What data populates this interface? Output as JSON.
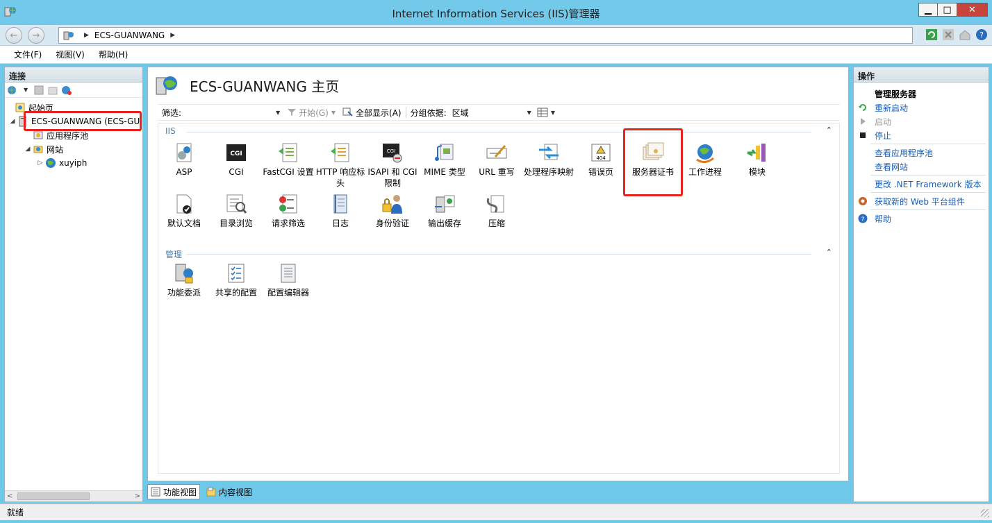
{
  "window": {
    "title": "Internet Information Services (IIS)管理器",
    "controls": {
      "minimize": "▁",
      "maximize": "□",
      "close": "✕"
    }
  },
  "address_bar": {
    "back": "←",
    "forward": "→",
    "crumbs": [
      "ECS-GUANWANG"
    ]
  },
  "menu": [
    "文件(F)",
    "视图(V)",
    "帮助(H)"
  ],
  "connections": {
    "header": "连接",
    "tree": [
      {
        "label": "起始页",
        "icon": "start-page-icon"
      },
      {
        "label": "ECS-GUANWANG (ECS-GU",
        "icon": "server-icon",
        "selected": true
      },
      {
        "label": "应用程序池",
        "icon": "app-pool-icon"
      },
      {
        "label": "网站",
        "icon": "sites-folder-icon"
      },
      {
        "label": "xuyiph",
        "icon": "site-globe-icon"
      }
    ]
  },
  "main": {
    "title": "ECS-GUANWANG 主页",
    "filter_label": "筛选:",
    "go_label": "开始(G)",
    "show_all_label": "全部显示(A)",
    "group_by_label": "分组依据:",
    "group_by_value": "区域",
    "sections": [
      {
        "name": "IIS",
        "features": [
          {
            "label": "ASP",
            "icon": "asp-icon"
          },
          {
            "label": "CGI",
            "icon": "cgi-icon"
          },
          {
            "label": "FastCGI 设置",
            "icon": "fastcgi-icon"
          },
          {
            "label": "HTTP 响应标头",
            "icon": "http-headers-icon"
          },
          {
            "label": "ISAPI 和 CGI 限制",
            "icon": "isapi-cgi-icon"
          },
          {
            "label": "MIME 类型",
            "icon": "mime-icon"
          },
          {
            "label": "URL 重写",
            "icon": "url-rewrite-icon"
          },
          {
            "label": "处理程序映射",
            "icon": "handler-mappings-icon"
          },
          {
            "label": "错误页",
            "icon": "error-pages-icon"
          },
          {
            "label": "服务器证书",
            "icon": "server-certificates-icon"
          },
          {
            "label": "工作进程",
            "icon": "worker-processes-icon"
          },
          {
            "label": "模块",
            "icon": "modules-icon"
          },
          {
            "label": "默认文档",
            "icon": "default-document-icon"
          },
          {
            "label": "目录浏览",
            "icon": "directory-browsing-icon"
          },
          {
            "label": "请求筛选",
            "icon": "request-filtering-icon"
          },
          {
            "label": "日志",
            "icon": "logging-icon"
          },
          {
            "label": "身份验证",
            "icon": "authentication-icon"
          },
          {
            "label": "输出缓存",
            "icon": "output-caching-icon"
          },
          {
            "label": "压缩",
            "icon": "compression-icon"
          }
        ]
      },
      {
        "name": "管理",
        "features": [
          {
            "label": "功能委派",
            "icon": "feature-delegation-icon"
          },
          {
            "label": "共享的配置",
            "icon": "shared-config-icon"
          },
          {
            "label": "配置编辑器",
            "icon": "config-editor-icon"
          }
        ]
      }
    ],
    "tabs": [
      {
        "label": "功能视图",
        "active": true
      },
      {
        "label": "内容视图",
        "active": false
      }
    ]
  },
  "actions": {
    "header": "操作",
    "items": {
      "manage_server": "管理服务器",
      "restart": "重新启动",
      "start": "启动",
      "stop": "停止",
      "view_app_pools": "查看应用程序池",
      "view_sites": "查看网站",
      "change_net": "更改 .NET Framework 版本",
      "get_web_components": "获取新的 Web 平台组件",
      "help": "帮助"
    }
  },
  "status": "就绪",
  "colors": {
    "titlebar": "#72c9ea",
    "highlight": "#e8221c",
    "link": "#1a5fb4",
    "section": "#4f7fa8"
  }
}
